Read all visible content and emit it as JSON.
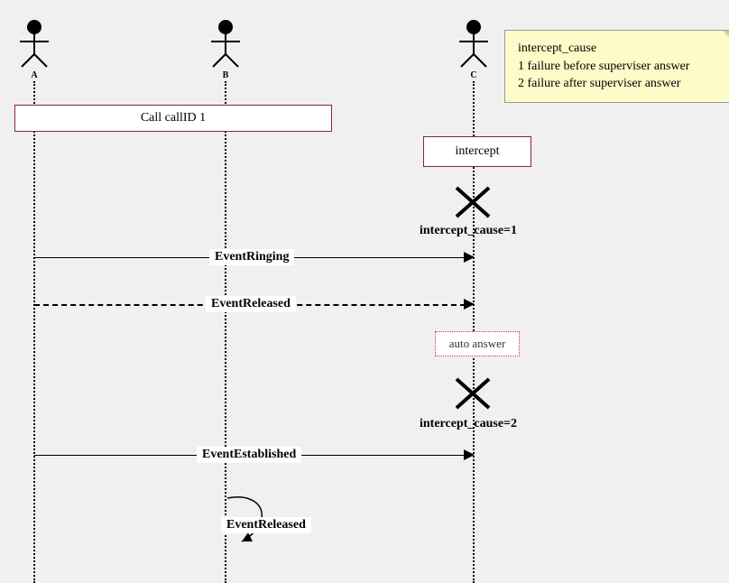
{
  "actors": {
    "a": "A",
    "b": "B",
    "c": "C"
  },
  "note": {
    "line1": "intercept_cause",
    "line2": "1 failure before superviser answer",
    "line3": "2 failure after superviser answer"
  },
  "boxes": {
    "call": "Call callID 1",
    "intercept": "intercept",
    "autoanswer": "auto answer"
  },
  "causes": {
    "cause1": "intercept_cause=1",
    "cause2": "intercept_cause=2"
  },
  "messages": {
    "ringing": "EventRinging",
    "released1": "EventReleased",
    "established": "EventEstablished",
    "released2": "EventReleased"
  },
  "chart_data": {
    "type": "sequence",
    "participants": [
      "A",
      "B",
      "C"
    ],
    "note": {
      "participant": "C",
      "text": "intercept_cause\n1 failure before superviser answer\n2 failure after superviser answer"
    },
    "events": [
      {
        "kind": "group",
        "label": "Call callID 1",
        "participants": [
          "A",
          "B"
        ]
      },
      {
        "kind": "box",
        "participant": "C",
        "label": "intercept"
      },
      {
        "kind": "failure",
        "participant": "C",
        "label": "intercept_cause=1"
      },
      {
        "kind": "message",
        "from": "A",
        "to": "C",
        "label": "EventRinging",
        "style": "solid"
      },
      {
        "kind": "message",
        "from": "A",
        "to": "C",
        "label": "EventReleased",
        "style": "dashed"
      },
      {
        "kind": "box",
        "participant": "C",
        "label": "auto answer",
        "style": "dotted"
      },
      {
        "kind": "failure",
        "participant": "C",
        "label": "intercept_cause=2"
      },
      {
        "kind": "message",
        "from": "A",
        "to": "C",
        "label": "EventEstablished",
        "style": "solid"
      },
      {
        "kind": "self-message",
        "participant": "B",
        "label": "EventReleased"
      }
    ]
  }
}
